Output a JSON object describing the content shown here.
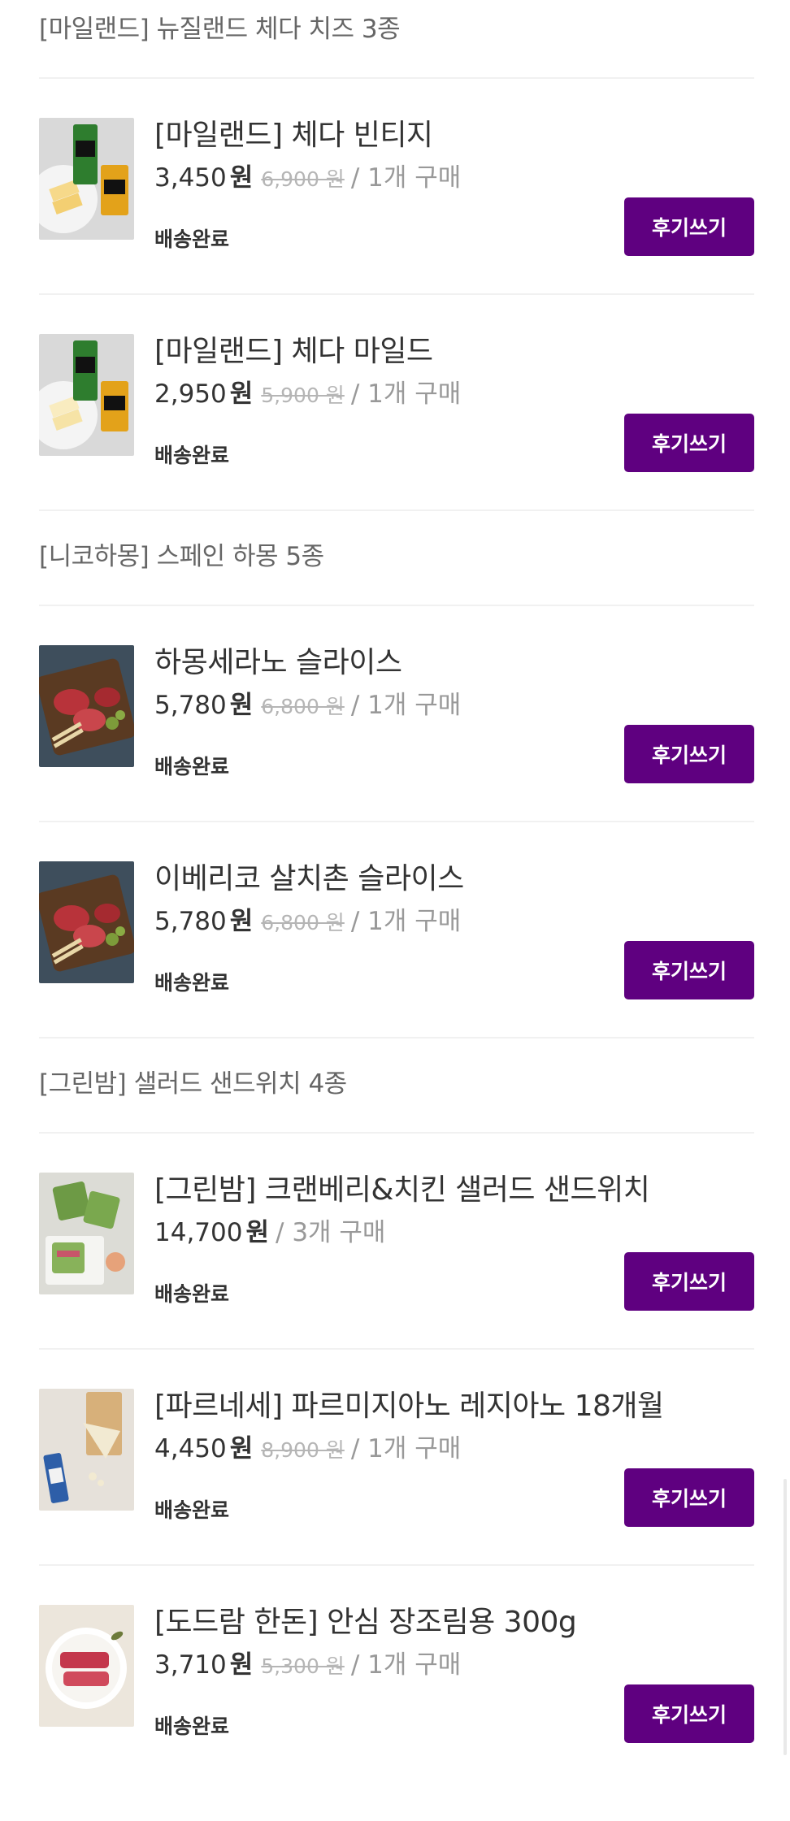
{
  "groups": [
    {
      "title": "[마일랜드] 뉴질랜드 체다 치즈 3종",
      "items": [
        {
          "name": "[마일랜드] 체다 빈티지",
          "price": "3,450",
          "currency": "원",
          "original_price": "6,900 원",
          "quantity": "/ 1개 구매",
          "status": "배송완료",
          "button": "후기쓰기",
          "image": "cheddar-vintage-photo"
        },
        {
          "name": "[마일랜드] 체다 마일드",
          "price": "2,950",
          "currency": "원",
          "original_price": "5,900 원",
          "quantity": "/ 1개 구매",
          "status": "배송완료",
          "button": "후기쓰기",
          "image": "cheddar-mild-photo"
        }
      ]
    },
    {
      "title": "[니코하몽] 스페인 하몽 5종",
      "items": [
        {
          "name": "하몽세라노 슬라이스",
          "price": "5,780",
          "currency": "원",
          "original_price": "6,800 원",
          "quantity": "/ 1개 구매",
          "status": "배송완료",
          "button": "후기쓰기",
          "image": "jamon-board-photo"
        },
        {
          "name": "이베리코 살치촌 슬라이스",
          "price": "5,780",
          "currency": "원",
          "original_price": "6,800 원",
          "quantity": "/ 1개 구매",
          "status": "배송완료",
          "button": "후기쓰기",
          "image": "jamon-board-photo"
        }
      ]
    },
    {
      "title": "[그린밤] 샐러드 샌드위치 4종",
      "items": [
        {
          "name": "[그린밤] 크랜베리&치킨 샐러드 샌드위치",
          "price": "14,700",
          "currency": "원",
          "original_price": "",
          "quantity": "/ 3개 구매",
          "status": "배송완료",
          "button": "후기쓰기",
          "image": "sandwich-photo"
        },
        {
          "name": "[파르네세] 파르미지아노 레지아노 18개월",
          "price": "4,450",
          "currency": "원",
          "original_price": "8,900 원",
          "quantity": "/ 1개 구매",
          "status": "배송완료",
          "button": "후기쓰기",
          "image": "parmigiano-photo"
        },
        {
          "name": "[도드람 한돈] 안심 장조림용 300g",
          "price": "3,710",
          "currency": "원",
          "original_price": "5,300 원",
          "quantity": "/ 1개 구매",
          "status": "배송완료",
          "button": "후기쓰기",
          "image": "pork-tenderloin-photo"
        }
      ]
    }
  ],
  "colors": {
    "accent": "#5f0080",
    "strike": "#b5b5b5",
    "muted": "#999999",
    "divider": "#f1f1f1"
  }
}
